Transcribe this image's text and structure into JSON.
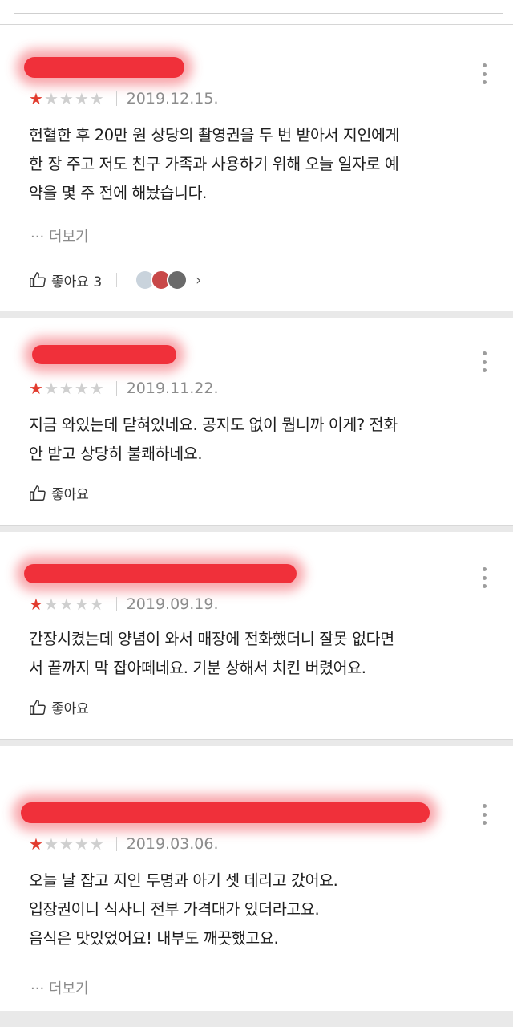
{
  "colors": {
    "redaction": "#f0303a",
    "star_filled": "#e23b2e",
    "star_empty": "#cfcfcf",
    "meta_text": "#8c8c8c"
  },
  "icons": {
    "more": "vertical-ellipsis-icon",
    "like": "thumbs-up-icon",
    "chevron": "chevron-right-icon"
  },
  "reviews": [
    {
      "rating": 1,
      "date": "2019.12.15.",
      "lines": [
        "헌혈한 후 20만 원 상당의 촬영권을 두 번 받아서 지인에게",
        "한 장 주고 저도 친구 가족과 사용하기 위해 오늘 일자로 예",
        "약을 몇 주 전에 해놨습니다."
      ],
      "more_label": "··· 더보기",
      "like_label": "좋아요 3",
      "chevron": "›"
    },
    {
      "rating": 1,
      "date": "2019.11.22.",
      "lines": [
        "지금 와있는데 닫혀있네요. 공지도 없이 뭡니까 이게? 전화",
        "안 받고 상당히 불쾌하네요."
      ],
      "like_label": "좋아요"
    },
    {
      "rating": 1,
      "date": "2019.09.19.",
      "lines": [
        "간장시켰는데 양념이 와서 매장에 전화했더니 잘못 없다면",
        "서 끝까지 막 잡아떼네요. 기분 상해서 치킨 버렸어요."
      ],
      "like_label": "좋아요"
    },
    {
      "rating": 1,
      "date": "2019.03.06.",
      "lines": [
        "오늘 날 잡고 지인 두명과 아기 셋 데리고 갔어요.",
        "입장권이니 식사니 전부 가격대가 있더라고요.",
        "음식은 맛있었어요! 내부도 깨끗했고요."
      ],
      "more_label": "··· 더보기"
    }
  ]
}
